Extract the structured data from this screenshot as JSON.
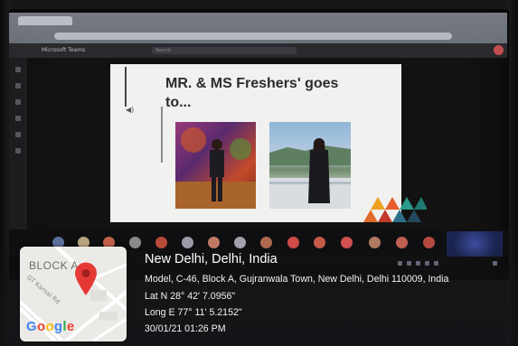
{
  "teams": {
    "app_name": "Microsoft Teams",
    "search_placeholder": "Search"
  },
  "slide": {
    "title": "MR. & MS Freshers' goes to..."
  },
  "geotag": {
    "map_label": "BLOCK A",
    "map_road_label": "GT Karnal Rd",
    "map_brand": "Google",
    "city_line": "New Delhi, Delhi, India",
    "address_line": "Model, C-46, Block A, Gujranwala Town, New Delhi, Delhi 110009, India",
    "latitude_line": "Lat N 28° 42' 7.0956\"",
    "longitude_line": "Long E 77° 11' 5.2152\"",
    "timestamp_line": "30/01/21 01:26 PM"
  },
  "colors": {
    "pin_red": "#e53935",
    "google_blue": "#4285F4",
    "google_red": "#EA4335",
    "google_yellow": "#FBBC05",
    "google_green": "#34A853"
  }
}
